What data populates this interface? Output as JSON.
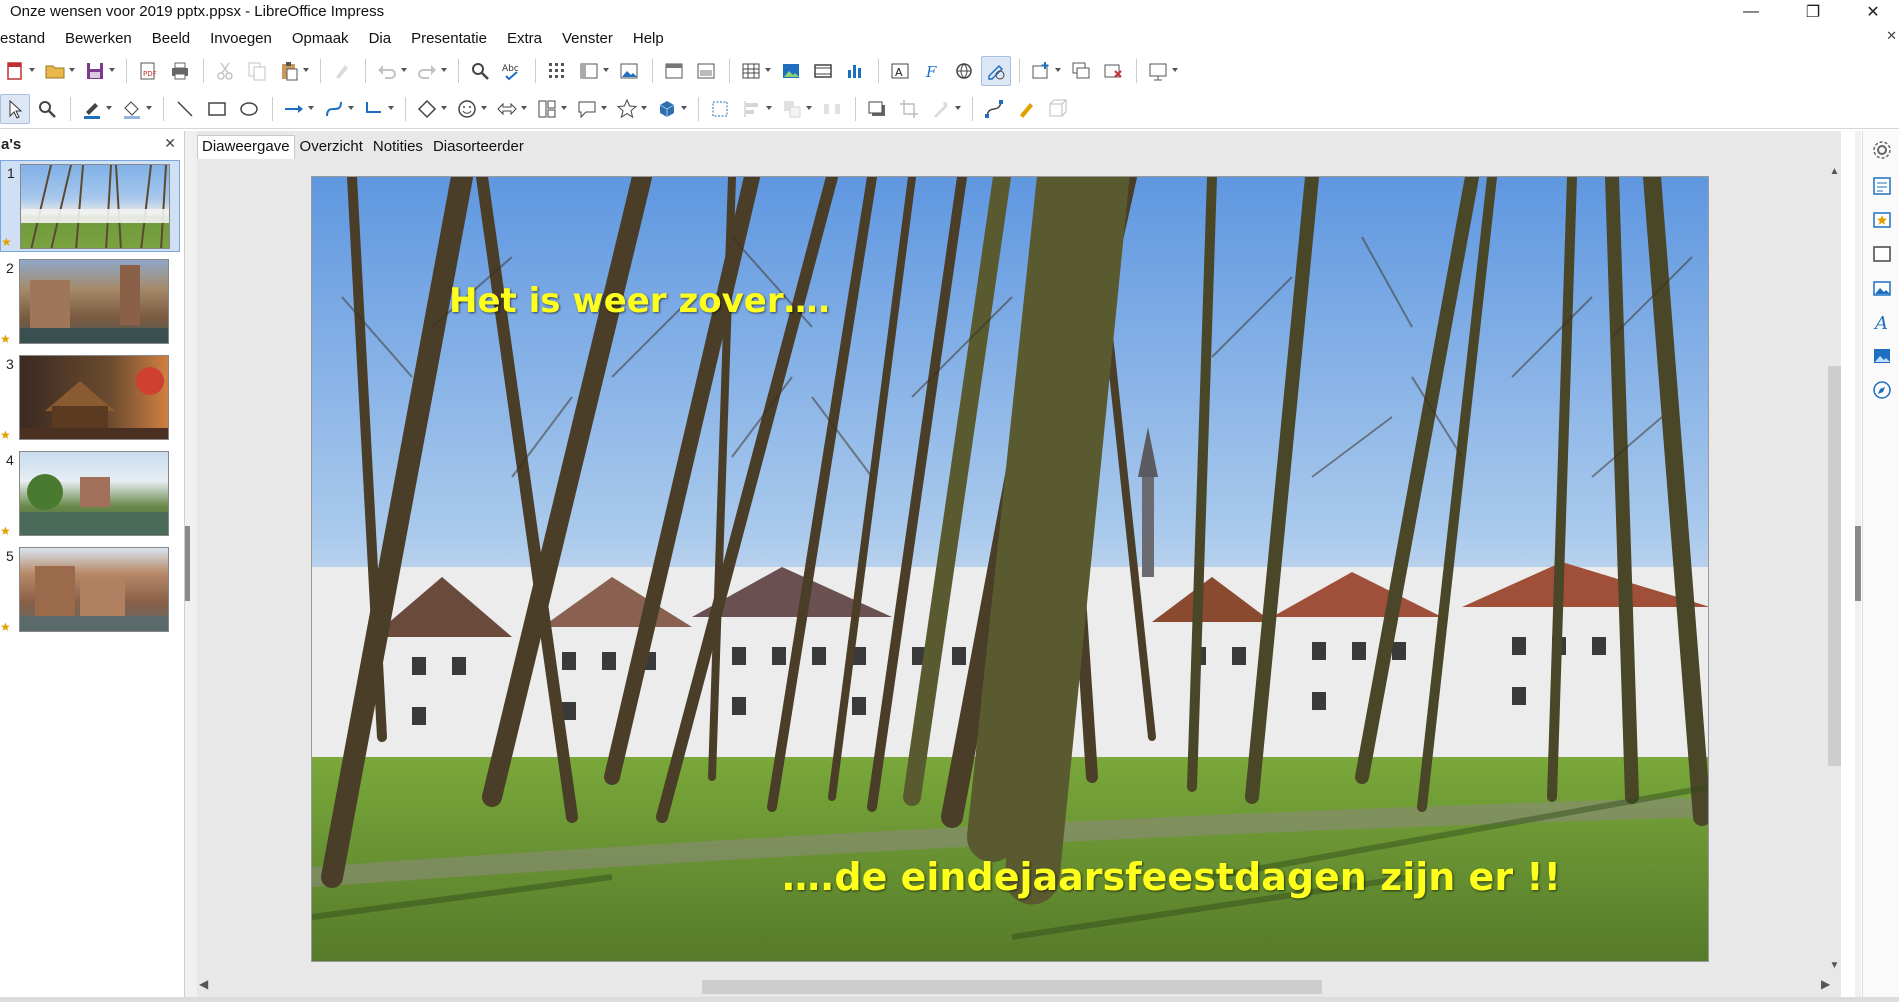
{
  "window": {
    "title": "Onze wensen voor 2019 pptx.ppsx - LibreOffice Impress",
    "minimize": "—",
    "maximize": "❐",
    "close": "✕"
  },
  "menu": [
    "estand",
    "Bewerken",
    "Beeld",
    "Invoegen",
    "Opmaak",
    "Dia",
    "Presentatie",
    "Extra",
    "Venster",
    "Help"
  ],
  "doc_close": "✕",
  "slide_pane": {
    "title": "a's",
    "close": "✕",
    "slides": [
      {
        "number": "1",
        "selected": true
      },
      {
        "number": "2",
        "selected": false
      },
      {
        "number": "3",
        "selected": false
      },
      {
        "number": "4",
        "selected": false
      },
      {
        "number": "5",
        "selected": false
      }
    ]
  },
  "view_tabs": [
    "Diaweergave",
    "Overzicht",
    "Notities",
    "Diasorteerder"
  ],
  "active_tab": "Diaweergave",
  "slide": {
    "text_1": "Het is weer zover….",
    "text_2": "….de eindejaarsfeestdagen zijn er !!",
    "text_color": "#ffff1e"
  },
  "scroll": {
    "up": "▲",
    "down": "▼",
    "left": "◀",
    "right": "▶"
  },
  "colors": {
    "accent": "#1e6fc0",
    "selection": "#cfe0f5"
  }
}
